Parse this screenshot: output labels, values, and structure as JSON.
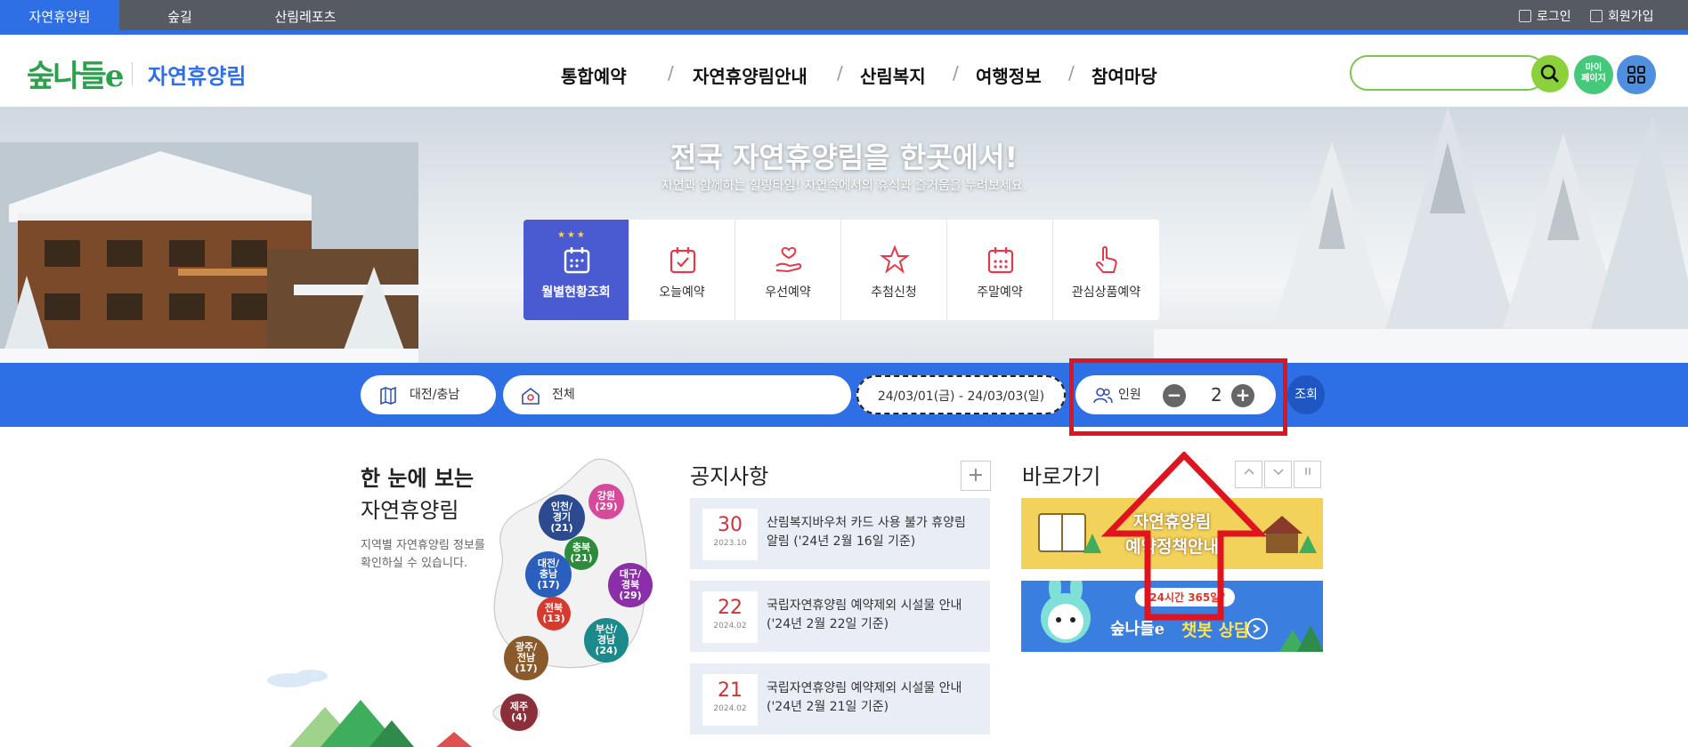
{
  "topbar": {
    "tabs": [
      {
        "label": "자연휴양림",
        "active": true
      },
      {
        "label": "숲길",
        "active": false
      },
      {
        "label": "산림레포츠",
        "active": false
      }
    ],
    "login": "로그인",
    "signup": "회원가입"
  },
  "header": {
    "logo": "숲나들e",
    "logo_sub": "자연휴양림",
    "nav": [
      "통합예약",
      "자연휴양림안내",
      "산림복지",
      "여행정보",
      "참여마당"
    ],
    "mypage_label": "마이\n페이지"
  },
  "hero": {
    "title": "전국 자연휴양림을 한곳에서!",
    "subtitle": "자연과 함께하는 힐링타임! 자연속에서의 휴식과 즐거움을 누려보세요.",
    "quick_menu": [
      {
        "label": "월별현황조회",
        "icon": "calendar-icon",
        "active": true
      },
      {
        "label": "오늘예약",
        "icon": "calendar-check-icon",
        "active": false
      },
      {
        "label": "우선예약",
        "icon": "hand-heart-icon",
        "active": false
      },
      {
        "label": "추첨신청",
        "icon": "star-icon",
        "active": false
      },
      {
        "label": "주말예약",
        "icon": "calendar-dots-icon",
        "active": false
      },
      {
        "label": "관심상품예약",
        "icon": "hand-click-icon",
        "active": false
      }
    ]
  },
  "search": {
    "region": "대전/충남",
    "forest": "전체",
    "dates": "24/03/01(금) - 24/03/03(일)",
    "people_label": "인원",
    "people_count": "2",
    "minus": "−",
    "plus": "+",
    "query_button": "조회"
  },
  "map_section": {
    "title_bold": "한 눈에 보는",
    "title_light": "자연휴양림",
    "description": "지역별 자연휴양림 정보를 확인하실 수 있습니다.",
    "regions": [
      {
        "label": "강원",
        "count": "(29)",
        "color": "#d64a9b"
      },
      {
        "label": "인천/\n경기",
        "count": "(21)",
        "color": "#2c4a8f"
      },
      {
        "label": "충북",
        "count": "(21)",
        "color": "#2e8b3c"
      },
      {
        "label": "대전/\n충남",
        "count": "(17)",
        "color": "#2b5fbd"
      },
      {
        "label": "대구/\n경북",
        "count": "(29)",
        "color": "#8b2fa8"
      },
      {
        "label": "전북",
        "count": "(13)",
        "color": "#d63a2f"
      },
      {
        "label": "부산/\n경남",
        "count": "(24)",
        "color": "#1a8a8a"
      },
      {
        "label": "광주/\n전남",
        "count": "(17)",
        "color": "#8b5a2b"
      },
      {
        "label": "제주",
        "count": "(4)",
        "color": "#8b2f3a"
      }
    ]
  },
  "notice_section": {
    "title": "공지사항",
    "more": "+",
    "items": [
      {
        "day": "30",
        "ym": "2023.10",
        "text": "산림복지바우처 카드 사용 불가 휴양림 알림 ('24년 2월 16일 기준)"
      },
      {
        "day": "22",
        "ym": "2024.02",
        "text": "국립자연휴양림 예약제외 시설물 안내 ('24년 2월 22일 기준)"
      },
      {
        "day": "21",
        "ym": "2024.02",
        "text": "국립자연휴양림 예약제외 시설물 안내 ('24년 2월 21일 기준)"
      }
    ]
  },
  "shortcut_section": {
    "title": "바로가기",
    "banner1_line1": "자연휴양림",
    "banner1_line2": "예약정책안내",
    "banner2_bubble": "\"24시간 365일\"",
    "banner2_logo": "숲나들e",
    "banner2_text": "챗봇 상담"
  },
  "colors": {
    "primary": "#2f6fe6",
    "active_quick": "#4a5bd1",
    "annotation_red": "#e0141e"
  }
}
